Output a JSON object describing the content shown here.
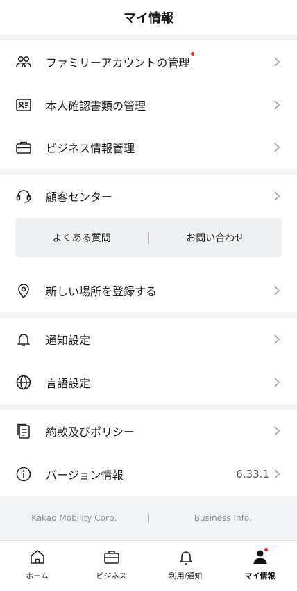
{
  "header": {
    "title": "マイ情報"
  },
  "sections": [
    {
      "items": [
        {
          "label": "ファミリーアカウントの管理",
          "icon": "family-icon",
          "badge": true
        },
        {
          "label": "本人確認書類の管理",
          "icon": "id-card-icon"
        },
        {
          "label": "ビジネス情報管理",
          "icon": "briefcase-icon"
        }
      ]
    },
    {
      "items": [
        {
          "label": "顧客センター",
          "icon": "headset-icon"
        }
      ],
      "quick_links": [
        "よくある質問",
        "お問い合わせ"
      ],
      "extra": {
        "label": "新しい場所を登録する",
        "icon": "location-pin-icon"
      }
    },
    {
      "items": [
        {
          "label": "通知設定",
          "icon": "bell-icon"
        },
        {
          "label": "言語設定",
          "icon": "globe-icon"
        }
      ]
    },
    {
      "items": [
        {
          "label": "約款及びポリシー",
          "icon": "document-icon"
        },
        {
          "label": "バージョン情報",
          "icon": "info-icon",
          "value": "6.33.1"
        }
      ]
    }
  ],
  "footer": {
    "left": "Kakao Mobility Corp.",
    "right": "Business Info."
  },
  "tabbar": [
    {
      "label": "ホーム",
      "icon": "home-icon"
    },
    {
      "label": "ビジネス",
      "icon": "briefcase-icon"
    },
    {
      "label": "利用/通知",
      "icon": "bell-icon"
    },
    {
      "label": "マイ情報",
      "icon": "person-icon",
      "active": true,
      "badge": true
    }
  ],
  "colors": {
    "badge": "#e52b2b",
    "divider": "#f2f3f5",
    "quick_box": "#eef0f2"
  }
}
